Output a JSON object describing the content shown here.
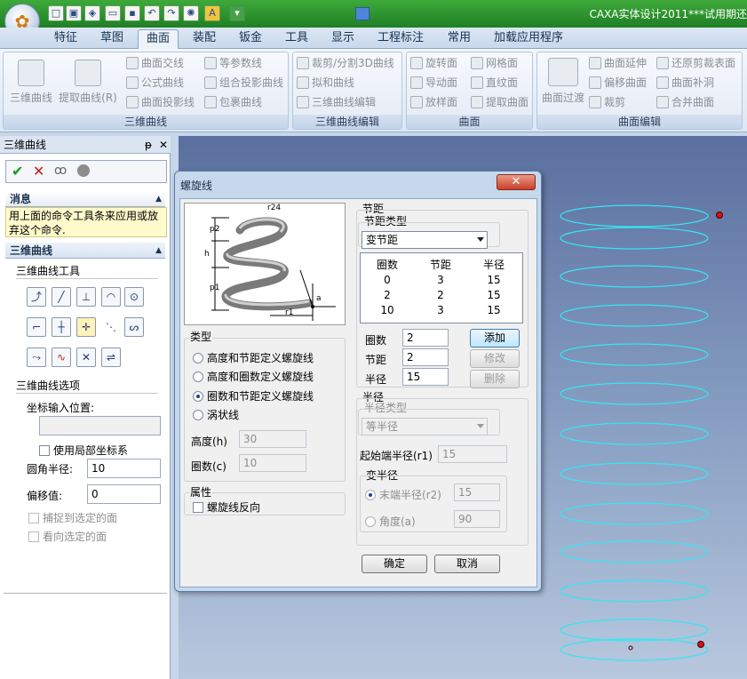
{
  "window": {
    "title": "CAXA实体设计2011***试用期还"
  },
  "tabs": [
    "特征",
    "草图",
    "曲面",
    "装配",
    "钣金",
    "工具",
    "显示",
    "工程标注",
    "常用",
    "加载应用程序"
  ],
  "ribbon": {
    "g1": {
      "label": "三维曲线",
      "big1": "三维曲线",
      "big2": "提取曲线(R)",
      "items": [
        "曲面交线",
        "等参数线",
        "公式曲线",
        "组合投影曲线",
        "曲面投影线",
        "包裹曲线"
      ]
    },
    "g2": {
      "label": "三维曲线编辑",
      "items": [
        "裁剪/分割3D曲线",
        "拟和曲线",
        "三维曲线编辑"
      ]
    },
    "g3": {
      "label": "曲面",
      "items": [
        "旋转面",
        "网格面",
        "导动面",
        "直纹面",
        "放样面",
        "提取曲面"
      ]
    },
    "g4": {
      "label": "曲面编辑",
      "big1": "曲面过渡",
      "items": [
        "曲面延伸",
        "还原剪裁表面",
        "偏移曲面",
        "曲面补洞",
        "裁剪",
        "合并曲面"
      ]
    }
  },
  "leftpanel": {
    "title": "三维曲线",
    "pin": "ᵽ",
    "close": "✕",
    "msg_head": "消息",
    "msg_text": "用上面的命令工具条来应用或放弃这个命令.",
    "curve_head": "三维曲线",
    "tools_label": "三维曲线工具",
    "options_label": "三维曲线选项",
    "coord_label": "坐标输入位置:",
    "local_cs": "使用局部坐标系",
    "fillet_label": "圆角半径:",
    "fillet_value": "10",
    "offset_label": "偏移值:",
    "offset_value": "0",
    "snap_face": "捕捉到选定的面",
    "look_face": "看向选定的面"
  },
  "dialog": {
    "title": "螺旋线",
    "close": "✕",
    "type_label": "类型",
    "types": [
      "高度和节距定义螺旋线",
      "高度和圈数定义螺旋线",
      "圈数和节距定义螺旋线",
      "涡状线"
    ],
    "selected_type": 2,
    "height_label": "高度(h)",
    "height_value": "30",
    "turns_label": "圈数(c)",
    "turns_value": "10",
    "attr_label": "属性",
    "reverse": "螺旋线反向",
    "pitch_group": "节距",
    "pitch_type_label": "节距类型",
    "pitch_type": "变节距",
    "table_headers": [
      "圈数",
      "节距",
      "半径"
    ],
    "table_rows": [
      [
        "0",
        "3",
        "15"
      ],
      [
        "2",
        "2",
        "15"
      ],
      [
        "10",
        "3",
        "15"
      ]
    ],
    "turns_field_label": "圈数",
    "turns_field": "2",
    "pitch_field_label": "节距",
    "pitch_field": "2",
    "radius_field_label": "半径",
    "radius_field": "15",
    "add": "添加",
    "modify": "修改",
    "delete": "删除",
    "radius_group": "半径",
    "radius_type_label": "半径类型",
    "radius_type": "等半径",
    "start_radius_label": "起始端半径(r1)",
    "start_radius": "15",
    "var_radius": "变半径",
    "end_radius_label": "末端半径(r2)",
    "end_radius": "15",
    "angle_label": "角度(a)",
    "angle": "90",
    "ok": "确定",
    "cancel": "取消",
    "figure": {
      "r24": "r24",
      "p2": "p2",
      "h": "h",
      "p1": "p1",
      "r1": "r1",
      "a": "a"
    }
  },
  "colors": {
    "spiral": "#35e6f2",
    "marker": "#d81010",
    "titlebar": "#2a8f2c"
  }
}
